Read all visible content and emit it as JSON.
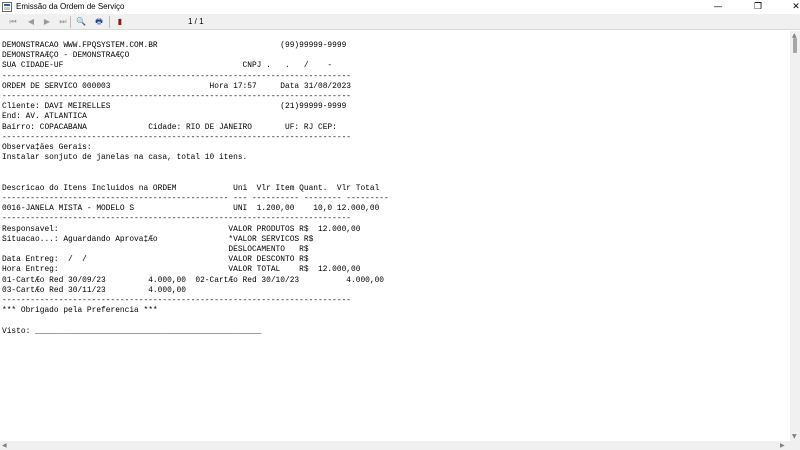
{
  "window": {
    "title": "Emissão da Ordem de Serviço",
    "minimize": "—",
    "maximize": "❐",
    "close": "✕"
  },
  "toolbar": {
    "page_indicator": "1 / 1",
    "buttons": [
      {
        "icon": "first-page-icon",
        "glyph": "⏮"
      },
      {
        "icon": "prev-page-icon",
        "glyph": "◀"
      },
      {
        "icon": "next-page-icon",
        "glyph": "▶"
      },
      {
        "icon": "last-page-icon",
        "glyph": "⏭"
      },
      {
        "icon": "zoom-icon",
        "glyph": "🔍"
      },
      {
        "icon": "print-icon",
        "glyph": "🖶"
      },
      {
        "icon": "exit-icon",
        "glyph": "▮"
      }
    ]
  },
  "report": {
    "line01": "DEMONSTRACAO WWW.FPQSYSTEM.COM.BR                          (99)99999-9999",
    "line02": "DEMONSTRAÆÇO - DEMONSTRAÆÇO",
    "line03": "SUA CIDADE-UF                                      CNPJ .   .   /    -",
    "line04": "--------------------------------------------------------------------------",
    "line05": "ORDEM DE SERVICO 000003                     Hora 17:57     Data 31/08/2023",
    "line06": "--------------------------------------------------------------------------",
    "line07": "Cliente: DAVI MEIRELLES                                    (21)99999-9999",
    "line08": "End: AV. ATLANTICA",
    "line09": "Bairro: COPACABANA             Cidade: RIO DE JANEIRO       UF: RJ CEP:",
    "line10": "--------------------------------------------------------------------------",
    "line11": "Observa‡äes Gerais:",
    "line12": "Instalar sonjuto de janelas na casa, total 10 itens.",
    "line13": "",
    "line14": "",
    "line15": "Descricao do Itens Incluidos na ORDEM            Uni  Vlr Item Quant.  Vlr Total",
    "line16": "------------------------------------------------ --- ---------- -------- ---------",
    "line17": "0016-JANELA MISTA - MODELO S                     UNI  1.200,00    10,0 12.000,00",
    "line18": "--------------------------------------------------------------------------",
    "line19": "Responsavel:                                    VALOR PRODUTOS R$  12.000,00",
    "line20": "Situacao...: Aguardando Aprova‡Æo               *VALOR SERVICOS R$",
    "line21": "                                                DESLOCAMENTO   R$",
    "line22": "Data Entreg:  /  /                              VALOR DESCONTO R$",
    "line23": "Hora Entreg:                                    VALOR TOTAL    R$  12.000,00",
    "line24": "01-CartÆo Red 30/09/23         4.000,00  02-CartÆo Red 30/10/23          4.000,00",
    "line25": "03-CartÆo Red 30/11/23         4.000,00",
    "line26": "--------------------------------------------------------------------------",
    "line27": "*** Obrigado pela Preferencia ***",
    "line28": "",
    "line29": "Visto: ________________________________________________"
  },
  "scrollbar": {
    "up": "▲",
    "down": "▼",
    "left": "◀",
    "right": "▶"
  }
}
